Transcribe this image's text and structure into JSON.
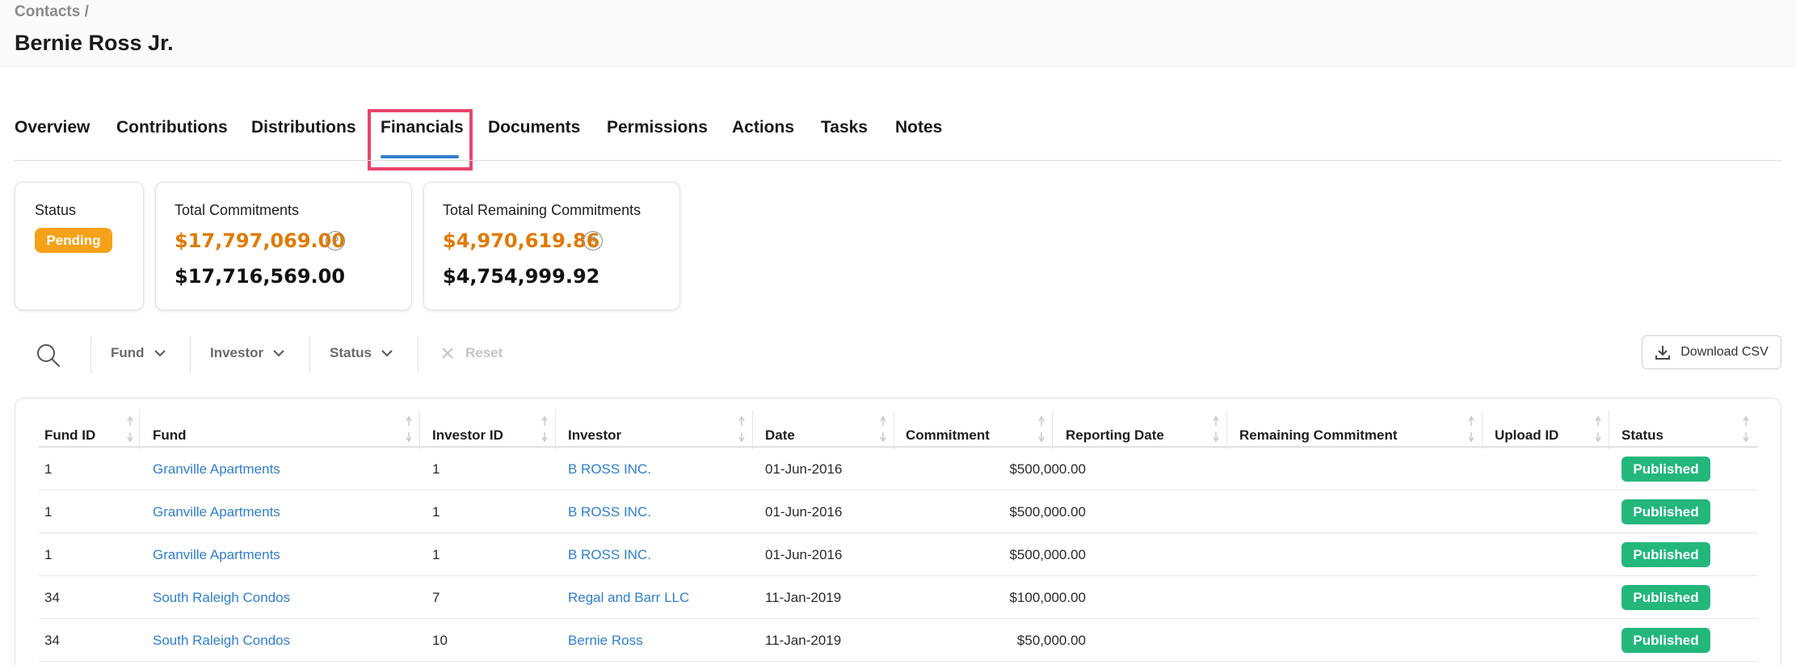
{
  "breadcrumb": "Contacts /",
  "page_title": "Bernie Ross Jr.",
  "tabs": [
    {
      "label": "Overview",
      "active": false
    },
    {
      "label": "Contributions",
      "active": false
    },
    {
      "label": "Distributions",
      "active": false
    },
    {
      "label": "Financials",
      "active": true
    },
    {
      "label": "Documents",
      "active": false
    },
    {
      "label": "Permissions",
      "active": false
    },
    {
      "label": "Actions",
      "active": false
    },
    {
      "label": "Tasks",
      "active": false
    },
    {
      "label": "Notes",
      "active": false
    }
  ],
  "cards": {
    "status": {
      "label": "Status",
      "value": "Pending",
      "color": "#f5a21a"
    },
    "total_commitments": {
      "label": "Total Commitments",
      "primary": "$17,797,069.00",
      "secondary": "$17,716,569.00"
    },
    "total_remaining": {
      "label": "Total Remaining Commitments",
      "primary": "$4,970,619.86",
      "secondary": "$4,754,999.92"
    },
    "help_icon": "?"
  },
  "filters": {
    "search_icon": "search-icon",
    "fund": "Fund",
    "investor": "Investor",
    "status": "Status",
    "reset": "Reset",
    "download": "Download CSV"
  },
  "table": {
    "columns": [
      "Fund ID",
      "Fund",
      "Investor ID",
      "Investor",
      "Date",
      "Commitment",
      "Reporting Date",
      "Remaining Commitment",
      "Upload ID",
      "Status"
    ],
    "rows": [
      {
        "fund_id": "1",
        "fund": "Granville Apartments",
        "investor_id": "1",
        "investor": "B ROSS INC.",
        "date": "01-Jun-2016",
        "commitment": "$500,000.00",
        "reporting_date": "",
        "remaining": "",
        "upload_id": "",
        "status": "Published"
      },
      {
        "fund_id": "1",
        "fund": "Granville Apartments",
        "investor_id": "1",
        "investor": "B ROSS INC.",
        "date": "01-Jun-2016",
        "commitment": "$500,000.00",
        "reporting_date": "",
        "remaining": "",
        "upload_id": "",
        "status": "Published"
      },
      {
        "fund_id": "1",
        "fund": "Granville Apartments",
        "investor_id": "1",
        "investor": "B ROSS INC.",
        "date": "01-Jun-2016",
        "commitment": "$500,000.00",
        "reporting_date": "",
        "remaining": "",
        "upload_id": "",
        "status": "Published"
      },
      {
        "fund_id": "34",
        "fund": "South Raleigh Condos",
        "investor_id": "7",
        "investor": "Regal and Barr LLC",
        "date": "11-Jan-2019",
        "commitment": "$100,000.00",
        "reporting_date": "",
        "remaining": "",
        "upload_id": "",
        "status": "Published"
      },
      {
        "fund_id": "34",
        "fund": "South Raleigh Condos",
        "investor_id": "10",
        "investor": "Bernie Ross",
        "date": "11-Jan-2019",
        "commitment": "$50,000.00",
        "reporting_date": "",
        "remaining": "",
        "upload_id": "",
        "status": "Published"
      }
    ]
  },
  "colors": {
    "accent": "#2f7fd0",
    "amount_highlight": "#e07a00",
    "published": "#23b77c",
    "pending": "#f5a21a",
    "active_tab_outline": "#e8456b"
  }
}
